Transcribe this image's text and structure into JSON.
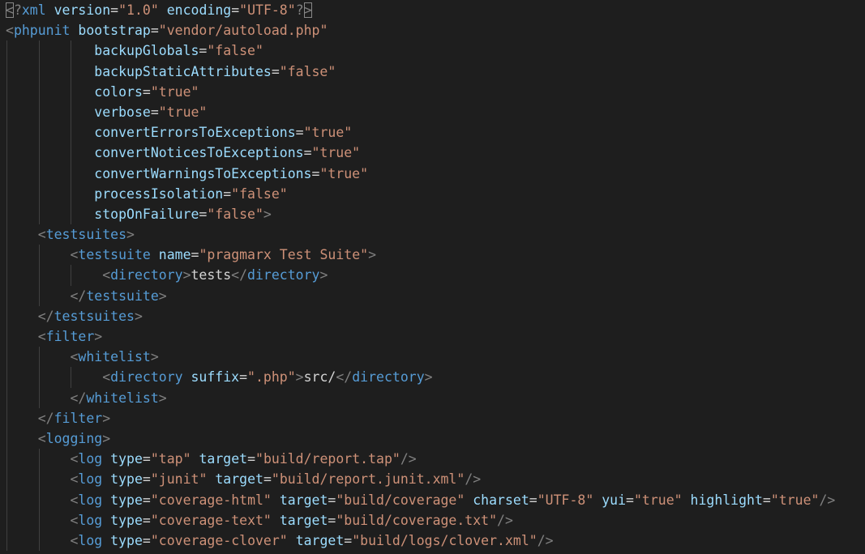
{
  "editor": {
    "language": "xml",
    "colors": {
      "background": "#1e1e1e",
      "punctuation": "#808080",
      "tag": "#569cd6",
      "attribute": "#9cdcfe",
      "value": "#ce9178",
      "text": "#d4d4d4",
      "indent_guide": "#404040"
    },
    "lines": [
      {
        "indent": 0,
        "guides": [],
        "tokens": [
          {
            "c": "punc",
            "t": "<",
            "box": true
          },
          {
            "c": "punc",
            "t": "?"
          },
          {
            "c": "tag",
            "t": "xml"
          },
          {
            "c": "text",
            "t": " "
          },
          {
            "c": "attr",
            "t": "version"
          },
          {
            "c": "eq",
            "t": "="
          },
          {
            "c": "val",
            "t": "\"1.0\""
          },
          {
            "c": "text",
            "t": " "
          },
          {
            "c": "attr",
            "t": "encoding"
          },
          {
            "c": "eq",
            "t": "="
          },
          {
            "c": "val",
            "t": "\"UTF-8\""
          },
          {
            "c": "punc",
            "t": "?"
          },
          {
            "c": "punc",
            "t": ">",
            "box": true
          }
        ]
      },
      {
        "indent": 0,
        "guides": [],
        "tokens": [
          {
            "c": "punc",
            "t": "<"
          },
          {
            "c": "tag",
            "t": "phpunit"
          },
          {
            "c": "text",
            "t": " "
          },
          {
            "c": "attr",
            "t": "bootstrap"
          },
          {
            "c": "eq",
            "t": "="
          },
          {
            "c": "val",
            "t": "\"vendor/autoload.php\""
          }
        ]
      },
      {
        "indent": 11,
        "guides": [
          0,
          4,
          8
        ],
        "tokens": [
          {
            "c": "attr",
            "t": "backupGlobals"
          },
          {
            "c": "eq",
            "t": "="
          },
          {
            "c": "val",
            "t": "\"false\""
          }
        ]
      },
      {
        "indent": 11,
        "guides": [
          0,
          4,
          8
        ],
        "tokens": [
          {
            "c": "attr",
            "t": "backupStaticAttributes"
          },
          {
            "c": "eq",
            "t": "="
          },
          {
            "c": "val",
            "t": "\"false\""
          }
        ]
      },
      {
        "indent": 11,
        "guides": [
          0,
          4,
          8
        ],
        "tokens": [
          {
            "c": "attr",
            "t": "colors"
          },
          {
            "c": "eq",
            "t": "="
          },
          {
            "c": "val",
            "t": "\"true\""
          }
        ]
      },
      {
        "indent": 11,
        "guides": [
          0,
          4,
          8
        ],
        "tokens": [
          {
            "c": "attr",
            "t": "verbose"
          },
          {
            "c": "eq",
            "t": "="
          },
          {
            "c": "val",
            "t": "\"true\""
          }
        ]
      },
      {
        "indent": 11,
        "guides": [
          0,
          4,
          8
        ],
        "tokens": [
          {
            "c": "attr",
            "t": "convertErrorsToExceptions"
          },
          {
            "c": "eq",
            "t": "="
          },
          {
            "c": "val",
            "t": "\"true\""
          }
        ]
      },
      {
        "indent": 11,
        "guides": [
          0,
          4,
          8
        ],
        "tokens": [
          {
            "c": "attr",
            "t": "convertNoticesToExceptions"
          },
          {
            "c": "eq",
            "t": "="
          },
          {
            "c": "val",
            "t": "\"true\""
          }
        ]
      },
      {
        "indent": 11,
        "guides": [
          0,
          4,
          8
        ],
        "tokens": [
          {
            "c": "attr",
            "t": "convertWarningsToExceptions"
          },
          {
            "c": "eq",
            "t": "="
          },
          {
            "c": "val",
            "t": "\"true\""
          }
        ]
      },
      {
        "indent": 11,
        "guides": [
          0,
          4,
          8
        ],
        "tokens": [
          {
            "c": "attr",
            "t": "processIsolation"
          },
          {
            "c": "eq",
            "t": "="
          },
          {
            "c": "val",
            "t": "\"false\""
          }
        ]
      },
      {
        "indent": 11,
        "guides": [
          0,
          4,
          8
        ],
        "tokens": [
          {
            "c": "attr",
            "t": "stopOnFailure"
          },
          {
            "c": "eq",
            "t": "="
          },
          {
            "c": "val",
            "t": "\"false\""
          },
          {
            "c": "punc",
            "t": ">"
          }
        ]
      },
      {
        "indent": 4,
        "guides": [
          0
        ],
        "tokens": [
          {
            "c": "punc",
            "t": "<"
          },
          {
            "c": "tag",
            "t": "testsuites"
          },
          {
            "c": "punc",
            "t": ">"
          }
        ]
      },
      {
        "indent": 8,
        "guides": [
          0,
          4
        ],
        "tokens": [
          {
            "c": "punc",
            "t": "<"
          },
          {
            "c": "tag",
            "t": "testsuite"
          },
          {
            "c": "text",
            "t": " "
          },
          {
            "c": "attr",
            "t": "name"
          },
          {
            "c": "eq",
            "t": "="
          },
          {
            "c": "val",
            "t": "\"pragmarx Test Suite\""
          },
          {
            "c": "punc",
            "t": ">"
          }
        ]
      },
      {
        "indent": 12,
        "guides": [
          0,
          4,
          8
        ],
        "tokens": [
          {
            "c": "punc",
            "t": "<"
          },
          {
            "c": "tag",
            "t": "directory"
          },
          {
            "c": "punc",
            "t": ">"
          },
          {
            "c": "text",
            "t": "tests"
          },
          {
            "c": "punc",
            "t": "</"
          },
          {
            "c": "tag",
            "t": "directory"
          },
          {
            "c": "punc",
            "t": ">"
          }
        ]
      },
      {
        "indent": 8,
        "guides": [
          0,
          4
        ],
        "tokens": [
          {
            "c": "punc",
            "t": "</"
          },
          {
            "c": "tag",
            "t": "testsuite"
          },
          {
            "c": "punc",
            "t": ">"
          }
        ]
      },
      {
        "indent": 4,
        "guides": [
          0
        ],
        "tokens": [
          {
            "c": "punc",
            "t": "</"
          },
          {
            "c": "tag",
            "t": "testsuites"
          },
          {
            "c": "punc",
            "t": ">"
          }
        ]
      },
      {
        "indent": 4,
        "guides": [
          0
        ],
        "tokens": [
          {
            "c": "punc",
            "t": "<"
          },
          {
            "c": "tag",
            "t": "filter"
          },
          {
            "c": "punc",
            "t": ">"
          }
        ]
      },
      {
        "indent": 8,
        "guides": [
          0,
          4
        ],
        "tokens": [
          {
            "c": "punc",
            "t": "<"
          },
          {
            "c": "tag",
            "t": "whitelist"
          },
          {
            "c": "punc",
            "t": ">"
          }
        ]
      },
      {
        "indent": 12,
        "guides": [
          0,
          4,
          8
        ],
        "tokens": [
          {
            "c": "punc",
            "t": "<"
          },
          {
            "c": "tag",
            "t": "directory"
          },
          {
            "c": "text",
            "t": " "
          },
          {
            "c": "attr",
            "t": "suffix"
          },
          {
            "c": "eq",
            "t": "="
          },
          {
            "c": "val",
            "t": "\".php\""
          },
          {
            "c": "punc",
            "t": ">"
          },
          {
            "c": "text",
            "t": "src/"
          },
          {
            "c": "punc",
            "t": "</"
          },
          {
            "c": "tag",
            "t": "directory"
          },
          {
            "c": "punc",
            "t": ">"
          }
        ]
      },
      {
        "indent": 8,
        "guides": [
          0,
          4
        ],
        "tokens": [
          {
            "c": "punc",
            "t": "</"
          },
          {
            "c": "tag",
            "t": "whitelist"
          },
          {
            "c": "punc",
            "t": ">"
          }
        ]
      },
      {
        "indent": 4,
        "guides": [
          0
        ],
        "tokens": [
          {
            "c": "punc",
            "t": "</"
          },
          {
            "c": "tag",
            "t": "filter"
          },
          {
            "c": "punc",
            "t": ">"
          }
        ]
      },
      {
        "indent": 4,
        "guides": [
          0
        ],
        "tokens": [
          {
            "c": "punc",
            "t": "<"
          },
          {
            "c": "tag",
            "t": "logging"
          },
          {
            "c": "punc",
            "t": ">"
          }
        ]
      },
      {
        "indent": 8,
        "guides": [
          0,
          4
        ],
        "tokens": [
          {
            "c": "punc",
            "t": "<"
          },
          {
            "c": "tag",
            "t": "log"
          },
          {
            "c": "text",
            "t": " "
          },
          {
            "c": "attr",
            "t": "type"
          },
          {
            "c": "eq",
            "t": "="
          },
          {
            "c": "val",
            "t": "\"tap\""
          },
          {
            "c": "text",
            "t": " "
          },
          {
            "c": "attr",
            "t": "target"
          },
          {
            "c": "eq",
            "t": "="
          },
          {
            "c": "val",
            "t": "\"build/report.tap\""
          },
          {
            "c": "punc",
            "t": "/>"
          }
        ]
      },
      {
        "indent": 8,
        "guides": [
          0,
          4
        ],
        "tokens": [
          {
            "c": "punc",
            "t": "<"
          },
          {
            "c": "tag",
            "t": "log"
          },
          {
            "c": "text",
            "t": " "
          },
          {
            "c": "attr",
            "t": "type"
          },
          {
            "c": "eq",
            "t": "="
          },
          {
            "c": "val",
            "t": "\"junit\""
          },
          {
            "c": "text",
            "t": " "
          },
          {
            "c": "attr",
            "t": "target"
          },
          {
            "c": "eq",
            "t": "="
          },
          {
            "c": "val",
            "t": "\"build/report.junit.xml\""
          },
          {
            "c": "punc",
            "t": "/>"
          }
        ]
      },
      {
        "indent": 8,
        "guides": [
          0,
          4
        ],
        "tokens": [
          {
            "c": "punc",
            "t": "<"
          },
          {
            "c": "tag",
            "t": "log"
          },
          {
            "c": "text",
            "t": " "
          },
          {
            "c": "attr",
            "t": "type"
          },
          {
            "c": "eq",
            "t": "="
          },
          {
            "c": "val",
            "t": "\"coverage-html\""
          },
          {
            "c": "text",
            "t": " "
          },
          {
            "c": "attr",
            "t": "target"
          },
          {
            "c": "eq",
            "t": "="
          },
          {
            "c": "val",
            "t": "\"build/coverage\""
          },
          {
            "c": "text",
            "t": " "
          },
          {
            "c": "attr",
            "t": "charset"
          },
          {
            "c": "eq",
            "t": "="
          },
          {
            "c": "val",
            "t": "\"UTF-8\""
          },
          {
            "c": "text",
            "t": " "
          },
          {
            "c": "attr",
            "t": "yui"
          },
          {
            "c": "eq",
            "t": "="
          },
          {
            "c": "val",
            "t": "\"true\""
          },
          {
            "c": "text",
            "t": " "
          },
          {
            "c": "attr",
            "t": "highlight"
          },
          {
            "c": "eq",
            "t": "="
          },
          {
            "c": "val",
            "t": "\"true\""
          },
          {
            "c": "punc",
            "t": "/>"
          }
        ]
      },
      {
        "indent": 8,
        "guides": [
          0,
          4
        ],
        "tokens": [
          {
            "c": "punc",
            "t": "<"
          },
          {
            "c": "tag",
            "t": "log"
          },
          {
            "c": "text",
            "t": " "
          },
          {
            "c": "attr",
            "t": "type"
          },
          {
            "c": "eq",
            "t": "="
          },
          {
            "c": "val",
            "t": "\"coverage-text\""
          },
          {
            "c": "text",
            "t": " "
          },
          {
            "c": "attr",
            "t": "target"
          },
          {
            "c": "eq",
            "t": "="
          },
          {
            "c": "val",
            "t": "\"build/coverage.txt\""
          },
          {
            "c": "punc",
            "t": "/>"
          }
        ]
      },
      {
        "indent": 8,
        "guides": [
          0,
          4
        ],
        "tokens": [
          {
            "c": "punc",
            "t": "<"
          },
          {
            "c": "tag",
            "t": "log"
          },
          {
            "c": "text",
            "t": " "
          },
          {
            "c": "attr",
            "t": "type"
          },
          {
            "c": "eq",
            "t": "="
          },
          {
            "c": "val",
            "t": "\"coverage-clover\""
          },
          {
            "c": "text",
            "t": " "
          },
          {
            "c": "attr",
            "t": "target"
          },
          {
            "c": "eq",
            "t": "="
          },
          {
            "c": "val",
            "t": "\"build/logs/clover.xml\""
          },
          {
            "c": "punc",
            "t": "/>"
          }
        ]
      }
    ]
  }
}
